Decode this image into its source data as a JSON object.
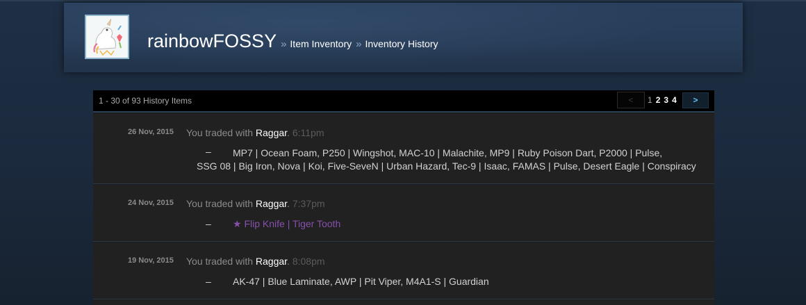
{
  "header": {
    "persona_name": "rainbowFOSSY",
    "separator": "»",
    "crumbs": [
      "Item Inventory",
      "Inventory History"
    ]
  },
  "pagination": {
    "count_text": "1 - 30 of 93 History Items",
    "prev_label": "<",
    "next_label": ">",
    "pages": [
      "1",
      "2",
      "3",
      "4"
    ],
    "current_page": "1"
  },
  "trades": [
    {
      "date": "26 Nov, 2015",
      "prefix": "You traded with ",
      "partner": "Raggar",
      "dot": ".",
      "time": "6:11pm",
      "dash": "–",
      "items_line1": "MP7 | Ocean Foam, P250 | Wingshot, MAC-10 | Malachite, MP9 | Ruby Poison Dart, P2000 | Pulse,",
      "items_line2": "SSG 08 | Big Iron, Nova | Koi, Five-SeveN | Urban Hazard, Tec-9 | Isaac, FAMAS | Pulse, Desert Eagle | Conspiracy"
    },
    {
      "date": "24 Nov, 2015",
      "prefix": "You traded with ",
      "partner": "Raggar",
      "dot": ".",
      "time": "7:37pm",
      "dash": "–",
      "items_line1": "★ Flip Knife | Tiger Tooth"
    },
    {
      "date": "19 Nov, 2015",
      "prefix": "You traded with ",
      "partner": "Raggar",
      "dot": ".",
      "time": "8:08pm",
      "dash": "–",
      "items_line1": "AK-47 | Blue Laminate, AWP | Pit Viper, M4A1-S | Guardian"
    }
  ],
  "colors": {
    "background": "#1b2838",
    "header": "#263b56",
    "row": "#212121",
    "accent_link": "#66c0f4",
    "covert_item": "#8650ac"
  },
  "icons": {
    "avatar": "unicorn-avatar-image"
  }
}
